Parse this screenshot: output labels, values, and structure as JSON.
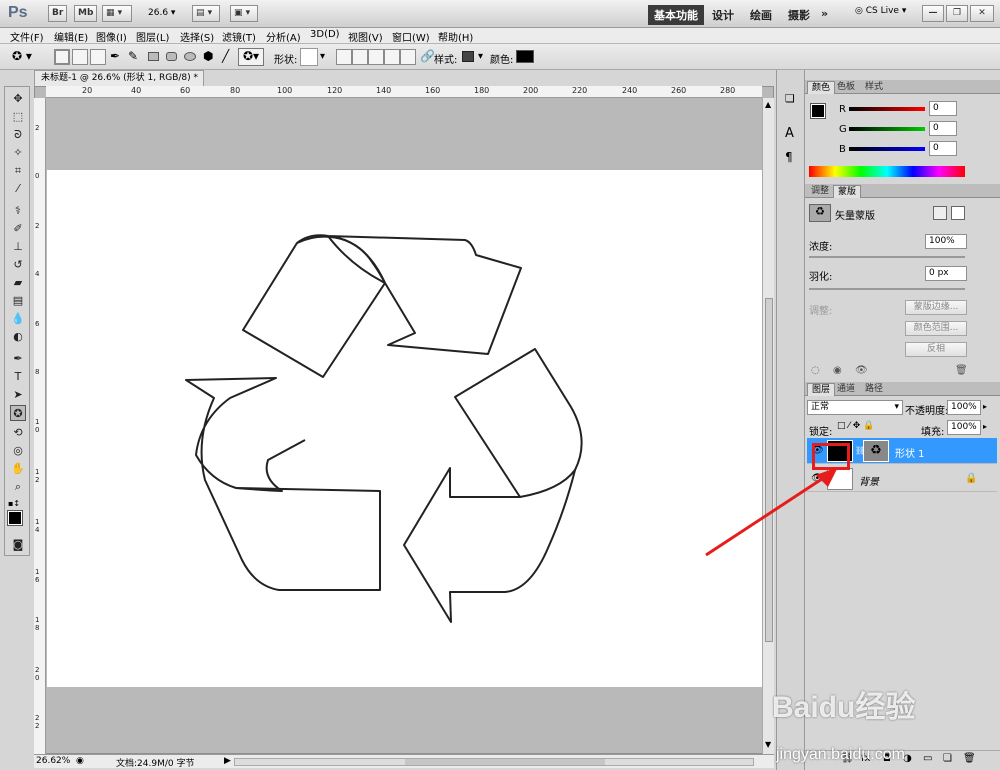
{
  "app": {
    "logo": "Ps",
    "bar_buttons": [
      "Br",
      "Mb"
    ],
    "zoom_value": "26.6",
    "workspaces": [
      "基本功能",
      "设计",
      "绘画",
      "摄影"
    ],
    "more": "»",
    "cs_live": "CS Live"
  },
  "menu": [
    "文件(F)",
    "编辑(E)",
    "图像(I)",
    "图层(L)",
    "选择(S)",
    "滤镜(T)",
    "分析(A)",
    "3D(D)",
    "视图(V)",
    "窗口(W)",
    "帮助(H)"
  ],
  "options": {
    "shape_label": "形状:",
    "style_label": "样式:",
    "color_label": "颜色:",
    "color_swatch": "#000000"
  },
  "document": {
    "tab_title": "未标题-1 @ 26.6% (形状 1, RGB/8) *",
    "ruler_h": [
      "20",
      "40",
      "60",
      "80",
      "100",
      "120",
      "140",
      "160",
      "180",
      "200",
      "220",
      "240",
      "260",
      "280"
    ],
    "ruler_v": [
      "2",
      "0",
      "2",
      "4",
      "6",
      "8",
      "10",
      "12",
      "14",
      "16",
      "18",
      "20",
      "22"
    ],
    "zoom": "26.62%",
    "doc_info": "文档:24.9M/0 字节"
  },
  "color_panel": {
    "tabs": [
      "颜色",
      "色板",
      "样式"
    ],
    "r_label": "R",
    "r_value": "0",
    "g_label": "G",
    "g_value": "0",
    "b_label": "B",
    "b_value": "0"
  },
  "mask_panel": {
    "tabs": [
      "调整",
      "蒙版"
    ],
    "title": "矢量蒙版",
    "density_label": "浓度:",
    "density_value": "100%",
    "feather_label": "羽化:",
    "feather_value": "0 px",
    "refine_label": "调整:",
    "buttons": [
      "蒙版边缘...",
      "颜色范围...",
      "反相"
    ]
  },
  "layers_panel": {
    "tabs": [
      "图层",
      "通道",
      "路径"
    ],
    "blend_mode": "正常",
    "opacity_label": "不透明度:",
    "opacity_value": "100%",
    "lock_label": "锁定:",
    "fill_label": "填充:",
    "fill_value": "100%",
    "layers": [
      {
        "name": "形状 1",
        "selected": true
      },
      {
        "name": "背景",
        "selected": false
      }
    ]
  },
  "watermark": {
    "text": "Baidu经验",
    "url": "jingyan.baidu.com"
  }
}
